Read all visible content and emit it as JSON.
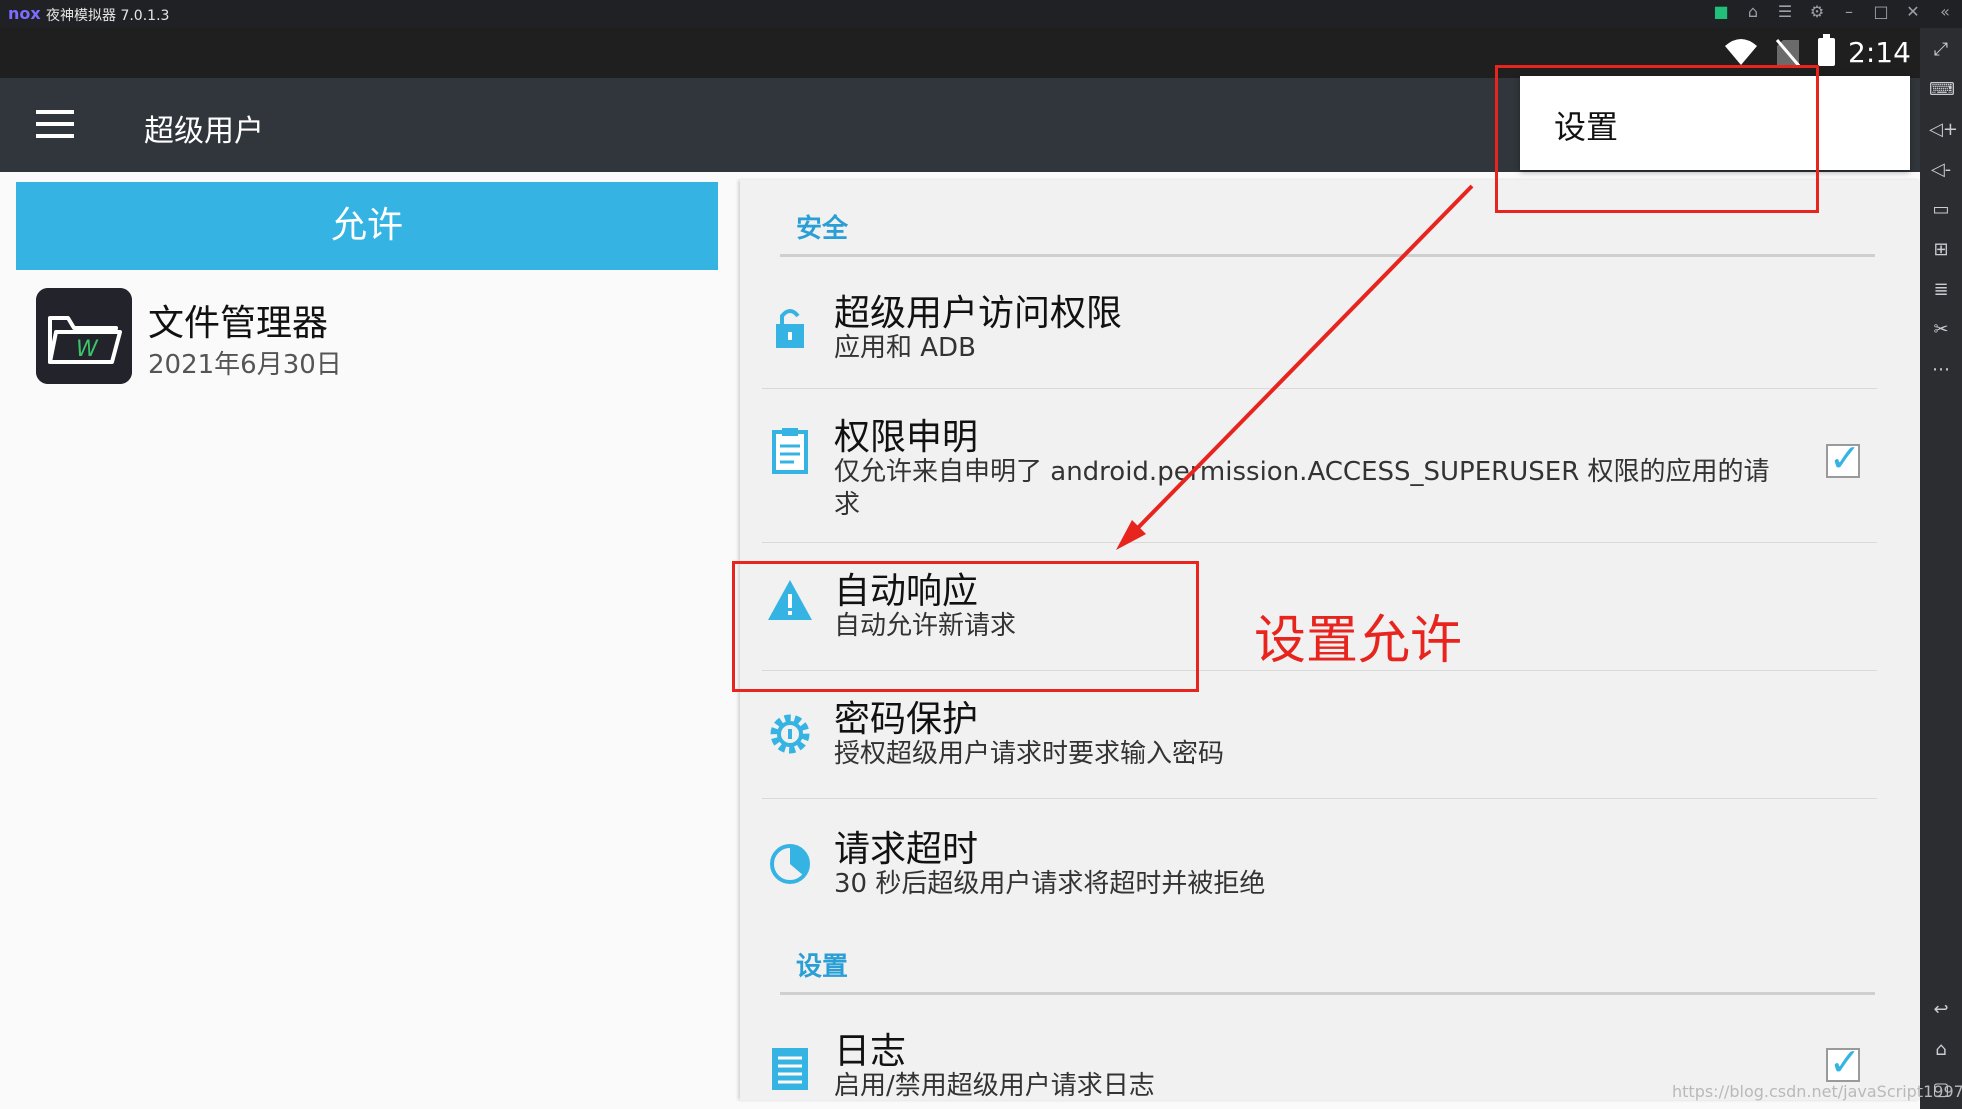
{
  "emulator": {
    "logo": "nox",
    "title": "夜神模拟器 7.0.1.3"
  },
  "status_bar": {
    "time": "2:14"
  },
  "app_bar": {
    "title": "超级用户"
  },
  "left_pane": {
    "tab_label": "允许",
    "apps": [
      {
        "name": "文件管理器",
        "date": "2021年6月30日"
      }
    ]
  },
  "settings": {
    "sections": [
      {
        "header": "安全"
      },
      {
        "header": "设置"
      }
    ],
    "items": [
      {
        "title": "超级用户访问权限",
        "summary": "应用和 ADB",
        "icon": "lock-icon"
      },
      {
        "title": "权限申明",
        "summary": "仅允许来自申明了 android.permission.ACCESS_SUPERUSER 权限的应用的请求",
        "checked": true,
        "icon": "clipboard-icon"
      },
      {
        "title": "自动响应",
        "summary": "自动允许新请求",
        "icon": "warning-icon"
      },
      {
        "title": "密码保护",
        "summary": "授权超级用户请求时要求输入密码",
        "icon": "gear-icon"
      },
      {
        "title": "请求超时",
        "summary": "30 秒后超级用户请求将超时并被拒绝",
        "icon": "clock-icon"
      },
      {
        "title": "日志",
        "summary": "启用/禁用超级用户请求日志",
        "checked": true,
        "icon": "list-icon"
      }
    ]
  },
  "overflow_menu": {
    "items": [
      "设置"
    ]
  },
  "annotation": {
    "text": "设置允许",
    "color": "#e8241e"
  },
  "watermark": "https://blog.csdn.net/javaScript1997",
  "colors": {
    "accent": "#35b4e3",
    "app_bar": "#30363b",
    "section_header": "#2a9fd6"
  }
}
